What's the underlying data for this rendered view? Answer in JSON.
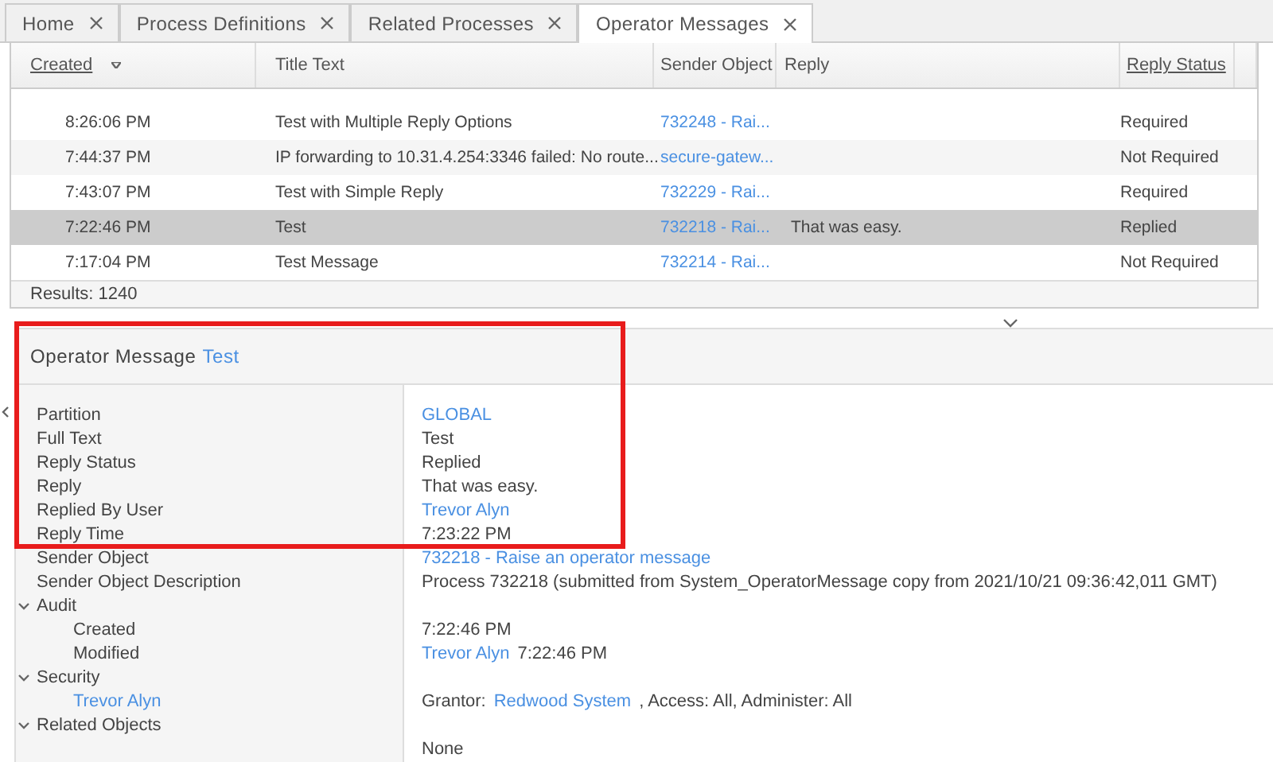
{
  "tabs": [
    {
      "label": "Home",
      "selected": false
    },
    {
      "label": "Process Definitions",
      "selected": false
    },
    {
      "label": "Related Processes",
      "selected": false
    },
    {
      "label": "Operator Messages",
      "selected": true
    }
  ],
  "table": {
    "columns": [
      {
        "label": "Created",
        "sortable": true,
        "sorted": true
      },
      {
        "label": "Title Text",
        "sortable": false,
        "sorted": false
      },
      {
        "label": "Sender Object",
        "sortable": false,
        "sorted": false
      },
      {
        "label": "Reply",
        "sortable": false,
        "sorted": false
      },
      {
        "label": "Reply Status",
        "sortable": true,
        "sorted": false
      }
    ],
    "rows": [
      {
        "created": "8:26:06 PM",
        "title": "Test with Multiple Reply Options",
        "sender": "732248 - Rai...",
        "reply": "",
        "status": "Required",
        "selected": false
      },
      {
        "created": "7:44:37 PM",
        "title": "IP forwarding to 10.31.4.254:3346 failed: No route...",
        "sender": "secure-gatew...",
        "reply": "",
        "status": "Not Required",
        "selected": false
      },
      {
        "created": "7:43:07 PM",
        "title": "Test with Simple Reply",
        "sender": "732229 - Rai...",
        "reply": "",
        "status": "Required",
        "selected": false
      },
      {
        "created": "7:22:46 PM",
        "title": "Test",
        "sender": "732218 - Rai...",
        "reply": "That was easy.",
        "status": "Replied",
        "selected": true
      },
      {
        "created": "7:17:04 PM",
        "title": "Test Message",
        "sender": "732214 - Rai...",
        "reply": "",
        "status": "Not Required",
        "selected": false
      }
    ],
    "results": "Results: 1240"
  },
  "detail": {
    "title": "Operator Message",
    "title_link": "Test",
    "highlighted": true,
    "fields": [
      {
        "label": "Partition",
        "value": [
          {
            "text": "GLOBAL",
            "link": true
          }
        ]
      },
      {
        "label": "Full Text",
        "value": [
          {
            "text": "Test",
            "link": false
          }
        ]
      },
      {
        "label": "Reply Status",
        "value": [
          {
            "text": "Replied",
            "link": false
          }
        ]
      },
      {
        "label": "Reply",
        "value": [
          {
            "text": "That was easy.",
            "link": false
          }
        ]
      },
      {
        "label": "Replied By User",
        "value": [
          {
            "text": "Trevor Alyn",
            "link": true
          }
        ]
      },
      {
        "label": "Reply Time",
        "value": [
          {
            "text": "7:23:22 PM",
            "link": false
          }
        ]
      },
      {
        "label": "Sender Object",
        "value": [
          {
            "text": "732218 - Raise an operator message",
            "link": true
          }
        ]
      },
      {
        "label": "Sender Object Description",
        "value": [
          {
            "text": "Process 732218 (submitted from System_OperatorMessage copy from 2021/10/21 09:36:42,011 GMT)",
            "link": false
          }
        ]
      }
    ],
    "sections": [
      {
        "label": "Audit",
        "expanded": true,
        "fields": [
          {
            "label": "Created",
            "value": [
              {
                "text": "7:22:46 PM",
                "link": false
              }
            ]
          },
          {
            "label": "Modified",
            "value": [
              {
                "text": "Trevor Alyn",
                "link": true
              },
              {
                "text": "7:22:46 PM",
                "link": false
              }
            ]
          }
        ]
      },
      {
        "label": "Security",
        "expanded": true,
        "fields": [
          {
            "label": "Trevor Alyn",
            "label_link": true,
            "value": [
              {
                "text": "Grantor:",
                "link": false
              },
              {
                "text": "Redwood System",
                "link": true
              },
              {
                "text": ", Access: All, Administer: All",
                "link": false
              }
            ]
          }
        ]
      },
      {
        "label": "Related Objects",
        "expanded": true,
        "fields": [
          {
            "value": [
              {
                "text": "None",
                "link": false
              }
            ]
          }
        ]
      }
    ]
  }
}
